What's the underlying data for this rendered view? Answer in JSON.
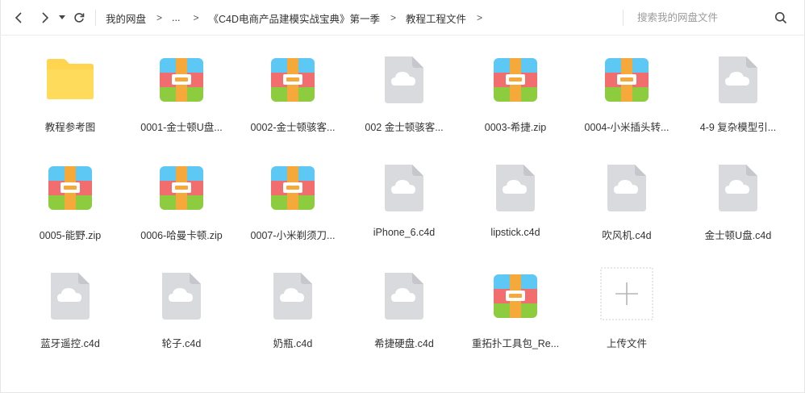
{
  "toolbar": {
    "back_icon": "chevron-left-icon",
    "forward_icon": "chevron-right-icon",
    "history_icon": "caret-down-icon",
    "refresh_icon": "refresh-icon",
    "breadcrumbs": [
      "我的网盘",
      "...",
      "《C4D电商产品建模实战宝典》第一季",
      "教程工程文件"
    ],
    "separator": ">",
    "search_placeholder": "搜索我的网盘文件",
    "search_icon": "search-icon"
  },
  "files": [
    {
      "name": "教程参考图",
      "type": "folder"
    },
    {
      "name": "0001-金士顿U盘...",
      "type": "zip"
    },
    {
      "name": "0002-金士顿骇客...",
      "type": "zip"
    },
    {
      "name": "002 金士顿骇客...",
      "type": "file"
    },
    {
      "name": "0003-希捷.zip",
      "type": "zip"
    },
    {
      "name": "0004-小米插头转...",
      "type": "zip"
    },
    {
      "name": "4-9 复杂模型引...",
      "type": "file"
    },
    {
      "name": "0005-能野.zip",
      "type": "zip"
    },
    {
      "name": "0006-哈曼卡顿.zip",
      "type": "zip"
    },
    {
      "name": "0007-小米剃须刀...",
      "type": "zip"
    },
    {
      "name": "iPhone_6.c4d",
      "type": "file"
    },
    {
      "name": "lipstick.c4d",
      "type": "file"
    },
    {
      "name": "吹风机.c4d",
      "type": "file"
    },
    {
      "name": "金士顿U盘.c4d",
      "type": "file"
    },
    {
      "name": "蓝牙遥控.c4d",
      "type": "file"
    },
    {
      "name": "轮子.c4d",
      "type": "file"
    },
    {
      "name": "奶瓶.c4d",
      "type": "file"
    },
    {
      "name": "希捷硬盘.c4d",
      "type": "file"
    },
    {
      "name": "重拓扑工具包_Re...",
      "type": "zip"
    },
    {
      "name": "上传文件",
      "type": "upload"
    }
  ],
  "colors": {
    "folder": "#ffd54f",
    "zip_blue": "#5ec8f5",
    "zip_red": "#f26d6d",
    "zip_green": "#8dcc3f",
    "zip_strap": "#f5a93a",
    "file_gray": "#d9dade"
  }
}
